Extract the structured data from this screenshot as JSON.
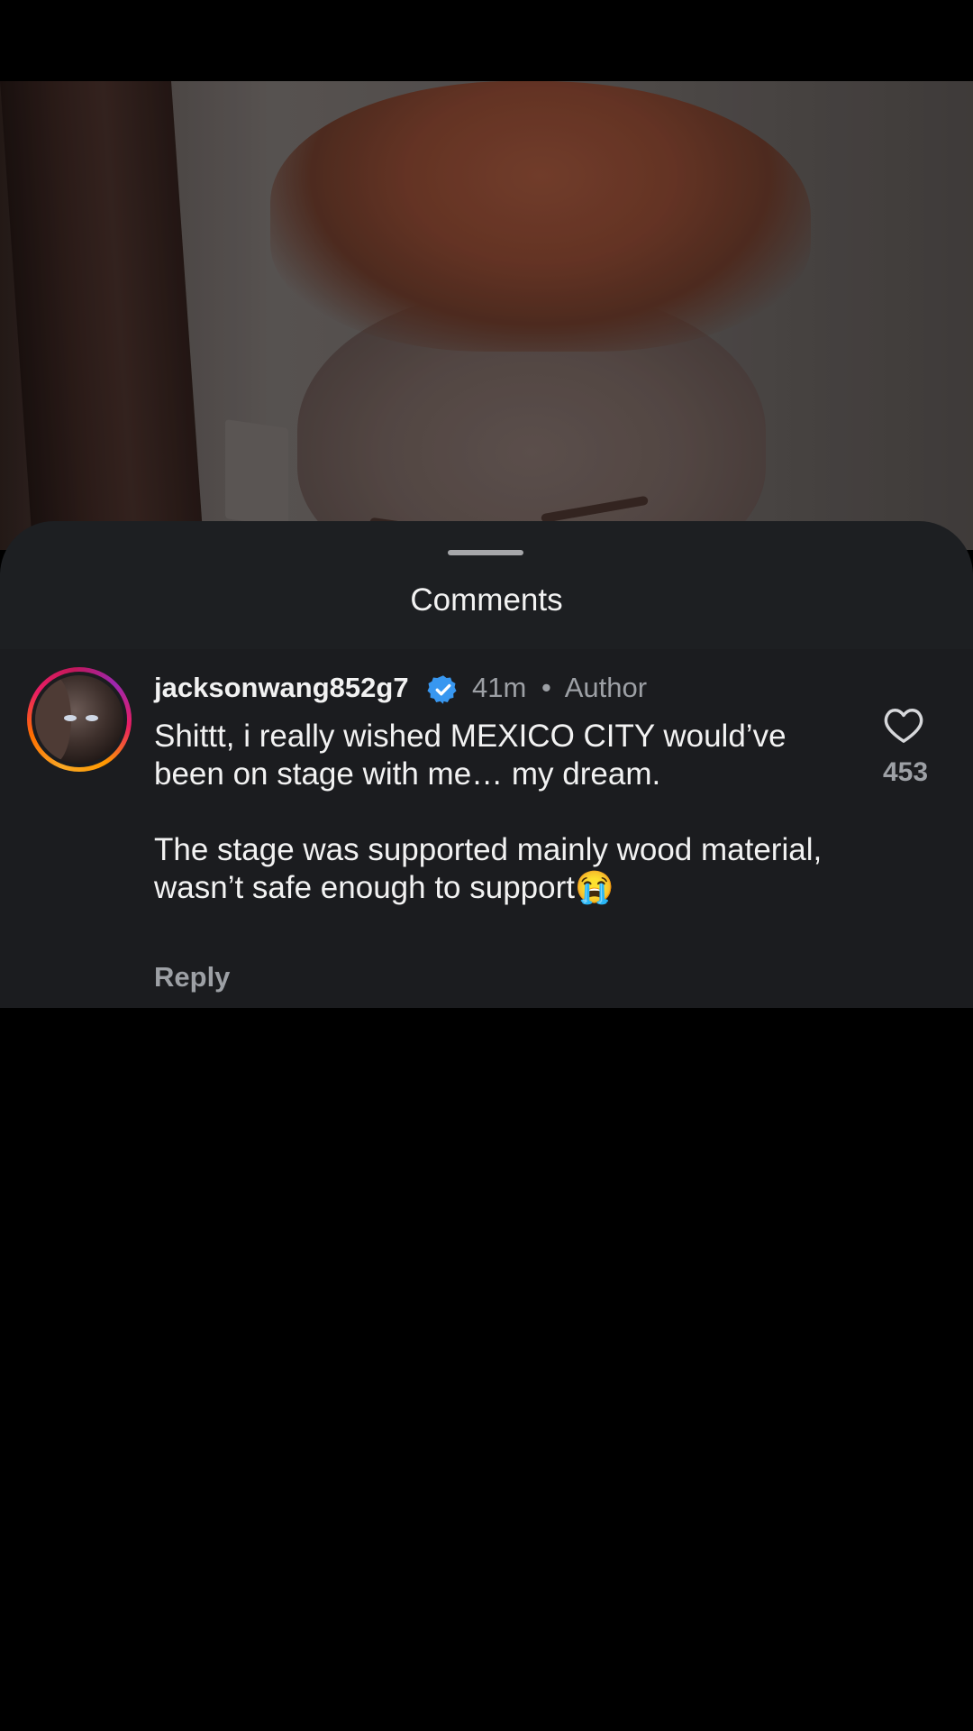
{
  "sheet": {
    "title": "Comments"
  },
  "comment": {
    "username": "jacksonwang852g7",
    "time": "41m",
    "separator": "•",
    "role": "Author",
    "text": "Shittt, i really wished MEXICO CITY would’ve been on stage with me… my dream.\n\nThe stage was supported mainly wood material, wasn’t safe enough to support😭",
    "reply_label": "Reply",
    "likes": "453"
  },
  "icons": {
    "verified": "verified-badge-icon",
    "like": "heart-outline-icon"
  },
  "colors": {
    "sheet_bg": "#1d1f22",
    "verified_blue": "#3897f0",
    "muted_text": "#9da0a5"
  }
}
